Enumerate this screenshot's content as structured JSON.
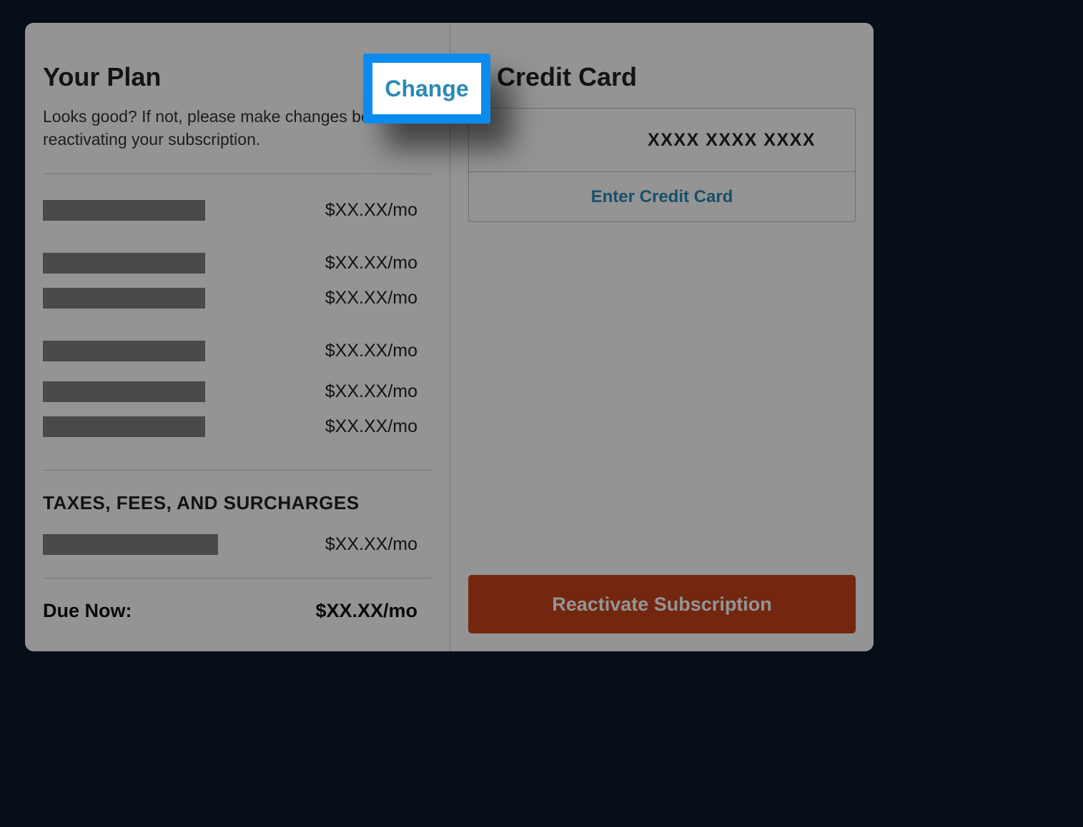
{
  "plan": {
    "title": "Your Plan",
    "description": "Looks good? If not, please make changes before reactivating your subscription.",
    "change_label": "Change",
    "items": [
      {
        "price": "$XX.XX/mo"
      },
      {
        "price": "$XX.XX/mo"
      },
      {
        "price": "$XX.XX/mo"
      },
      {
        "price": "$XX.XX/mo"
      },
      {
        "price": "$XX.XX/mo"
      },
      {
        "price": "$XX.XX/mo"
      }
    ],
    "taxes_title": "TAXES, FEES, AND SURCHARGES",
    "taxes_price": "$XX.XX/mo",
    "due_label": "Due Now:",
    "due_price": "$XX.XX/mo"
  },
  "cc": {
    "title": "Credit Card",
    "masked": "XXXX XXXX XXXX",
    "enter_label": "Enter Credit Card"
  },
  "action": {
    "reactivate_label": "Reactivate Subscription"
  }
}
